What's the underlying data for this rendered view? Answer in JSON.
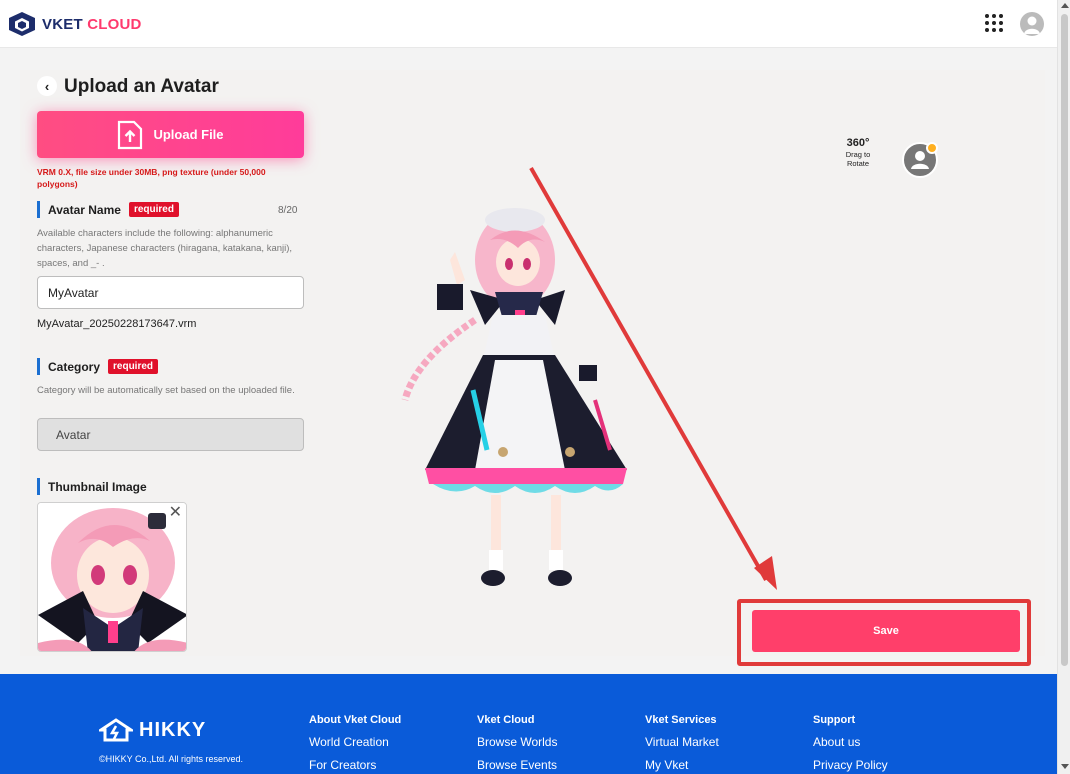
{
  "header": {
    "brand_first": "VKET",
    "brand_second": "CLOUD"
  },
  "page": {
    "back_glyph": "‹",
    "title": "Upload an Avatar"
  },
  "upload": {
    "button_label": "Upload File",
    "note": "VRM 0.X, file size under 30MB, png texture (under 50,000 polygons)"
  },
  "avatar_name": {
    "label": "Avatar Name",
    "required": "required",
    "count": "8/20",
    "help": "Available characters include the following: alphanumeric characters, Japanese characters (hiragana, katakana, kanji), spaces, and _- .",
    "value": "MyAvatar",
    "filename": "MyAvatar_20250228173647.vrm"
  },
  "category": {
    "label": "Category",
    "required": "required",
    "help": "Category will be automatically set based on the uploaded file.",
    "value": "Avatar"
  },
  "thumbnail": {
    "label": "Thumbnail Image",
    "close_glyph": "✕"
  },
  "viewer": {
    "rotate_glyph": "360°",
    "rotate_line1": "Drag to",
    "rotate_line2": "Rotate"
  },
  "save_label": "Save",
  "footer": {
    "logo_text": "HIKKY",
    "copyright": "©HIKKY Co.,Ltd. All rights reserved.",
    "columns": [
      {
        "head": "About Vket Cloud",
        "links": [
          "World Creation",
          "For Creators"
        ]
      },
      {
        "head": "Vket Cloud",
        "links": [
          "Browse Worlds",
          "Browse Events"
        ]
      },
      {
        "head": "Vket Services",
        "links": [
          "Virtual Market",
          "My Vket"
        ]
      },
      {
        "head": "Support",
        "links": [
          "About us",
          "Privacy Policy"
        ]
      }
    ]
  },
  "colors": {
    "accent": "#ff3f6a",
    "annotation": "#e03a3a",
    "footer_bg": "#0a5bd9",
    "section_bar": "#1b6fd1"
  }
}
